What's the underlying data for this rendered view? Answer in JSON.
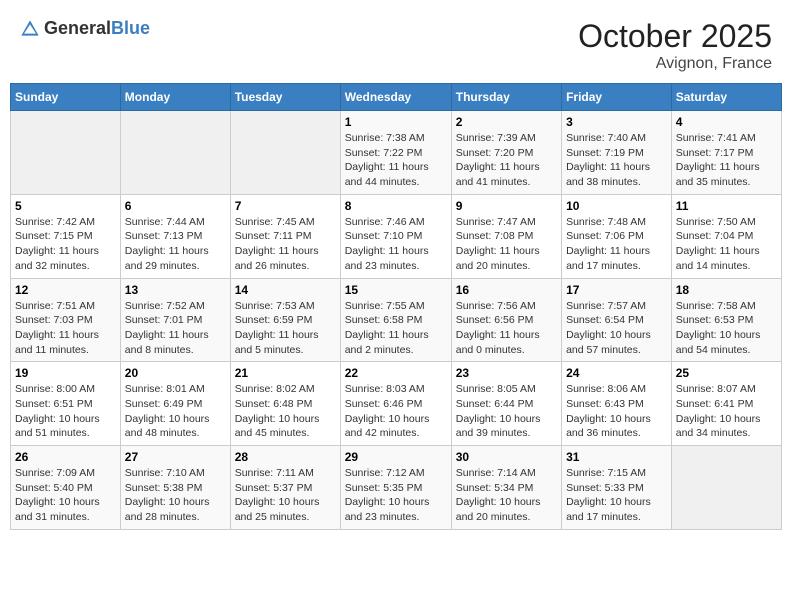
{
  "header": {
    "logo_general": "General",
    "logo_blue": "Blue",
    "month": "October 2025",
    "location": "Avignon, France"
  },
  "weekdays": [
    "Sunday",
    "Monday",
    "Tuesday",
    "Wednesday",
    "Thursday",
    "Friday",
    "Saturday"
  ],
  "weeks": [
    [
      {
        "day": "",
        "info": ""
      },
      {
        "day": "",
        "info": ""
      },
      {
        "day": "",
        "info": ""
      },
      {
        "day": "1",
        "info": "Sunrise: 7:38 AM\nSunset: 7:22 PM\nDaylight: 11 hours and 44 minutes."
      },
      {
        "day": "2",
        "info": "Sunrise: 7:39 AM\nSunset: 7:20 PM\nDaylight: 11 hours and 41 minutes."
      },
      {
        "day": "3",
        "info": "Sunrise: 7:40 AM\nSunset: 7:19 PM\nDaylight: 11 hours and 38 minutes."
      },
      {
        "day": "4",
        "info": "Sunrise: 7:41 AM\nSunset: 7:17 PM\nDaylight: 11 hours and 35 minutes."
      }
    ],
    [
      {
        "day": "5",
        "info": "Sunrise: 7:42 AM\nSunset: 7:15 PM\nDaylight: 11 hours and 32 minutes."
      },
      {
        "day": "6",
        "info": "Sunrise: 7:44 AM\nSunset: 7:13 PM\nDaylight: 11 hours and 29 minutes."
      },
      {
        "day": "7",
        "info": "Sunrise: 7:45 AM\nSunset: 7:11 PM\nDaylight: 11 hours and 26 minutes."
      },
      {
        "day": "8",
        "info": "Sunrise: 7:46 AM\nSunset: 7:10 PM\nDaylight: 11 hours and 23 minutes."
      },
      {
        "day": "9",
        "info": "Sunrise: 7:47 AM\nSunset: 7:08 PM\nDaylight: 11 hours and 20 minutes."
      },
      {
        "day": "10",
        "info": "Sunrise: 7:48 AM\nSunset: 7:06 PM\nDaylight: 11 hours and 17 minutes."
      },
      {
        "day": "11",
        "info": "Sunrise: 7:50 AM\nSunset: 7:04 PM\nDaylight: 11 hours and 14 minutes."
      }
    ],
    [
      {
        "day": "12",
        "info": "Sunrise: 7:51 AM\nSunset: 7:03 PM\nDaylight: 11 hours and 11 minutes."
      },
      {
        "day": "13",
        "info": "Sunrise: 7:52 AM\nSunset: 7:01 PM\nDaylight: 11 hours and 8 minutes."
      },
      {
        "day": "14",
        "info": "Sunrise: 7:53 AM\nSunset: 6:59 PM\nDaylight: 11 hours and 5 minutes."
      },
      {
        "day": "15",
        "info": "Sunrise: 7:55 AM\nSunset: 6:58 PM\nDaylight: 11 hours and 2 minutes."
      },
      {
        "day": "16",
        "info": "Sunrise: 7:56 AM\nSunset: 6:56 PM\nDaylight: 11 hours and 0 minutes."
      },
      {
        "day": "17",
        "info": "Sunrise: 7:57 AM\nSunset: 6:54 PM\nDaylight: 10 hours and 57 minutes."
      },
      {
        "day": "18",
        "info": "Sunrise: 7:58 AM\nSunset: 6:53 PM\nDaylight: 10 hours and 54 minutes."
      }
    ],
    [
      {
        "day": "19",
        "info": "Sunrise: 8:00 AM\nSunset: 6:51 PM\nDaylight: 10 hours and 51 minutes."
      },
      {
        "day": "20",
        "info": "Sunrise: 8:01 AM\nSunset: 6:49 PM\nDaylight: 10 hours and 48 minutes."
      },
      {
        "day": "21",
        "info": "Sunrise: 8:02 AM\nSunset: 6:48 PM\nDaylight: 10 hours and 45 minutes."
      },
      {
        "day": "22",
        "info": "Sunrise: 8:03 AM\nSunset: 6:46 PM\nDaylight: 10 hours and 42 minutes."
      },
      {
        "day": "23",
        "info": "Sunrise: 8:05 AM\nSunset: 6:44 PM\nDaylight: 10 hours and 39 minutes."
      },
      {
        "day": "24",
        "info": "Sunrise: 8:06 AM\nSunset: 6:43 PM\nDaylight: 10 hours and 36 minutes."
      },
      {
        "day": "25",
        "info": "Sunrise: 8:07 AM\nSunset: 6:41 PM\nDaylight: 10 hours and 34 minutes."
      }
    ],
    [
      {
        "day": "26",
        "info": "Sunrise: 7:09 AM\nSunset: 5:40 PM\nDaylight: 10 hours and 31 minutes."
      },
      {
        "day": "27",
        "info": "Sunrise: 7:10 AM\nSunset: 5:38 PM\nDaylight: 10 hours and 28 minutes."
      },
      {
        "day": "28",
        "info": "Sunrise: 7:11 AM\nSunset: 5:37 PM\nDaylight: 10 hours and 25 minutes."
      },
      {
        "day": "29",
        "info": "Sunrise: 7:12 AM\nSunset: 5:35 PM\nDaylight: 10 hours and 23 minutes."
      },
      {
        "day": "30",
        "info": "Sunrise: 7:14 AM\nSunset: 5:34 PM\nDaylight: 10 hours and 20 minutes."
      },
      {
        "day": "31",
        "info": "Sunrise: 7:15 AM\nSunset: 5:33 PM\nDaylight: 10 hours and 17 minutes."
      },
      {
        "day": "",
        "info": ""
      }
    ]
  ]
}
